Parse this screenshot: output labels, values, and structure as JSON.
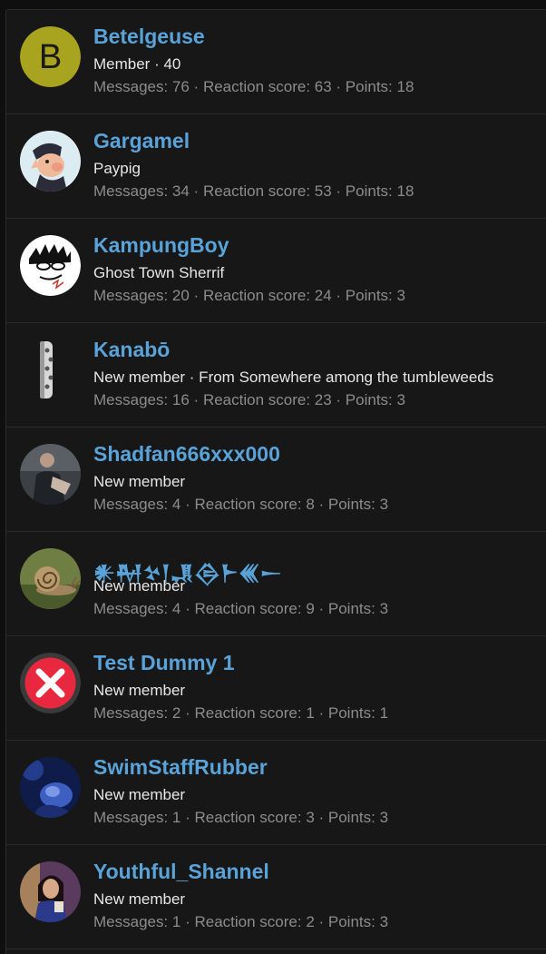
{
  "members": [
    {
      "name": "Betelgeuse",
      "title": "Member · 40",
      "stats": "Messages: 76 · Reaction score: 63 · Points: 18",
      "avatar": "letter-avatar",
      "avatar_letter": "B",
      "avatar_color": "#a8a41f"
    },
    {
      "name": "Gargamel",
      "title": "Paypig",
      "stats": "Messages: 34 · Reaction score: 53 · Points: 18",
      "avatar": "cartoon-avatar"
    },
    {
      "name": "KampungBoy",
      "title": "Ghost Town Sherrif",
      "stats": "Messages: 20 · Reaction score: 24 · Points: 3",
      "avatar": "sketch-avatar"
    },
    {
      "name": "Kanabō",
      "title": "New member · From Somewhere among the tumbleweeds",
      "stats": "Messages: 16 · Reaction score: 23 · Points: 3",
      "avatar": "club-avatar"
    },
    {
      "name": "Shadfan666xxx000",
      "title": "New member",
      "stats": "Messages: 4 · Reaction score: 8 · Points: 3",
      "avatar": "photo-avatar"
    },
    {
      "name": "𒀭𒈹𒆳𒁹𒂗𒁲𒈨𒌍𒀸",
      "title": "New member",
      "stats": "Messages: 4 · Reaction score: 9 · Points: 3",
      "avatar": "snail-avatar"
    },
    {
      "name": "Test Dummy 1",
      "title": "New member",
      "stats": "Messages: 2 · Reaction score: 1 · Points: 1",
      "avatar": "x-mark-avatar"
    },
    {
      "name": "SwimStaffRubber",
      "title": "New member",
      "stats": "Messages: 1 · Reaction score: 3 · Points: 3",
      "avatar": "underwater-avatar"
    },
    {
      "name": "Youthful_Shannel",
      "title": "New member",
      "stats": "Messages: 1 · Reaction score: 2 · Points: 3",
      "avatar": "portrait-avatar"
    }
  ]
}
